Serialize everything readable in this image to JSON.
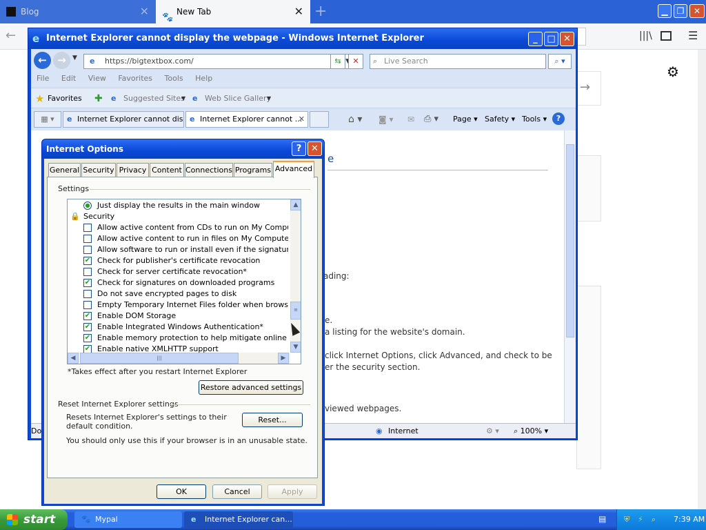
{
  "firefox": {
    "tabs": [
      {
        "label": "Blog"
      },
      {
        "label": "New Tab"
      }
    ]
  },
  "ie": {
    "title": "Internet Explorer cannot display the webpage - Windows Internet Explorer",
    "address": "https://bigtextbox.com/",
    "search_placeholder": "Live Search",
    "menu": [
      "File",
      "Edit",
      "View",
      "Favorites",
      "Tools",
      "Help"
    ],
    "favorites_label": "Favorites",
    "suggested_sites": "Suggested Sites",
    "web_slice_gallery": "Web Slice Gallery",
    "tabs": [
      {
        "label": "Internet Explorer cannot dis..."
      },
      {
        "label": "Internet Explorer cannot ..."
      }
    ],
    "command_bar": [
      "Page",
      "Safety",
      "Tools"
    ],
    "page_fragments": [
      "e",
      "ading:",
      "e.",
      "a listing for the website's domain.",
      "click Internet Options, click Advanced, and check to be",
      "er the security section.",
      "viewed webpages."
    ],
    "status": {
      "left": "Dor",
      "zone": "Internet",
      "zoom": "100%"
    }
  },
  "dialog": {
    "title": "Internet Options",
    "tabs": [
      "General",
      "Security",
      "Privacy",
      "Content",
      "Connections",
      "Programs",
      "Advanced"
    ],
    "settings_label": "Settings",
    "settings": [
      {
        "type": "radio",
        "checked": true,
        "label": "Just display the results in the main window"
      },
      {
        "type": "header",
        "label": "Security"
      },
      {
        "type": "checkbox",
        "checked": false,
        "label": "Allow active content from CDs to run on My Computer*"
      },
      {
        "type": "checkbox",
        "checked": false,
        "label": "Allow active content to run in files on My Computer*"
      },
      {
        "type": "checkbox",
        "checked": false,
        "label": "Allow software to run or install even if the signature is inv"
      },
      {
        "type": "checkbox",
        "checked": true,
        "label": "Check for publisher's certificate revocation"
      },
      {
        "type": "checkbox",
        "checked": false,
        "label": "Check for server certificate revocation*"
      },
      {
        "type": "checkbox",
        "checked": true,
        "label": "Check for signatures on downloaded programs"
      },
      {
        "type": "checkbox",
        "checked": false,
        "label": "Do not save encrypted pages to disk"
      },
      {
        "type": "checkbox",
        "checked": false,
        "label": "Empty Temporary Internet Files folder when browser is clo"
      },
      {
        "type": "checkbox",
        "checked": true,
        "label": "Enable DOM Storage"
      },
      {
        "type": "checkbox",
        "checked": true,
        "label": "Enable Integrated Windows Authentication*"
      },
      {
        "type": "checkbox",
        "checked": true,
        "label": "Enable memory protection to help mitigate online attacks*"
      },
      {
        "type": "checkbox",
        "checked": true,
        "label": "Enable native XMLHTTP support"
      }
    ],
    "restart_note": "*Takes effect after you restart Internet Explorer",
    "restore_button": "Restore advanced settings",
    "reset_group": "Reset Internet Explorer settings",
    "reset_desc": "Resets Internet Explorer's settings to their default condition.",
    "reset_button": "Reset...",
    "reset_warning": "You should only use this if your browser is in an unusable state.",
    "ok": "OK",
    "cancel": "Cancel",
    "apply": "Apply"
  },
  "taskbar": {
    "start": "start",
    "tasks": [
      {
        "label": "Mypal"
      },
      {
        "label": "Internet Explorer can..."
      }
    ],
    "clock": "7:39 AM"
  }
}
